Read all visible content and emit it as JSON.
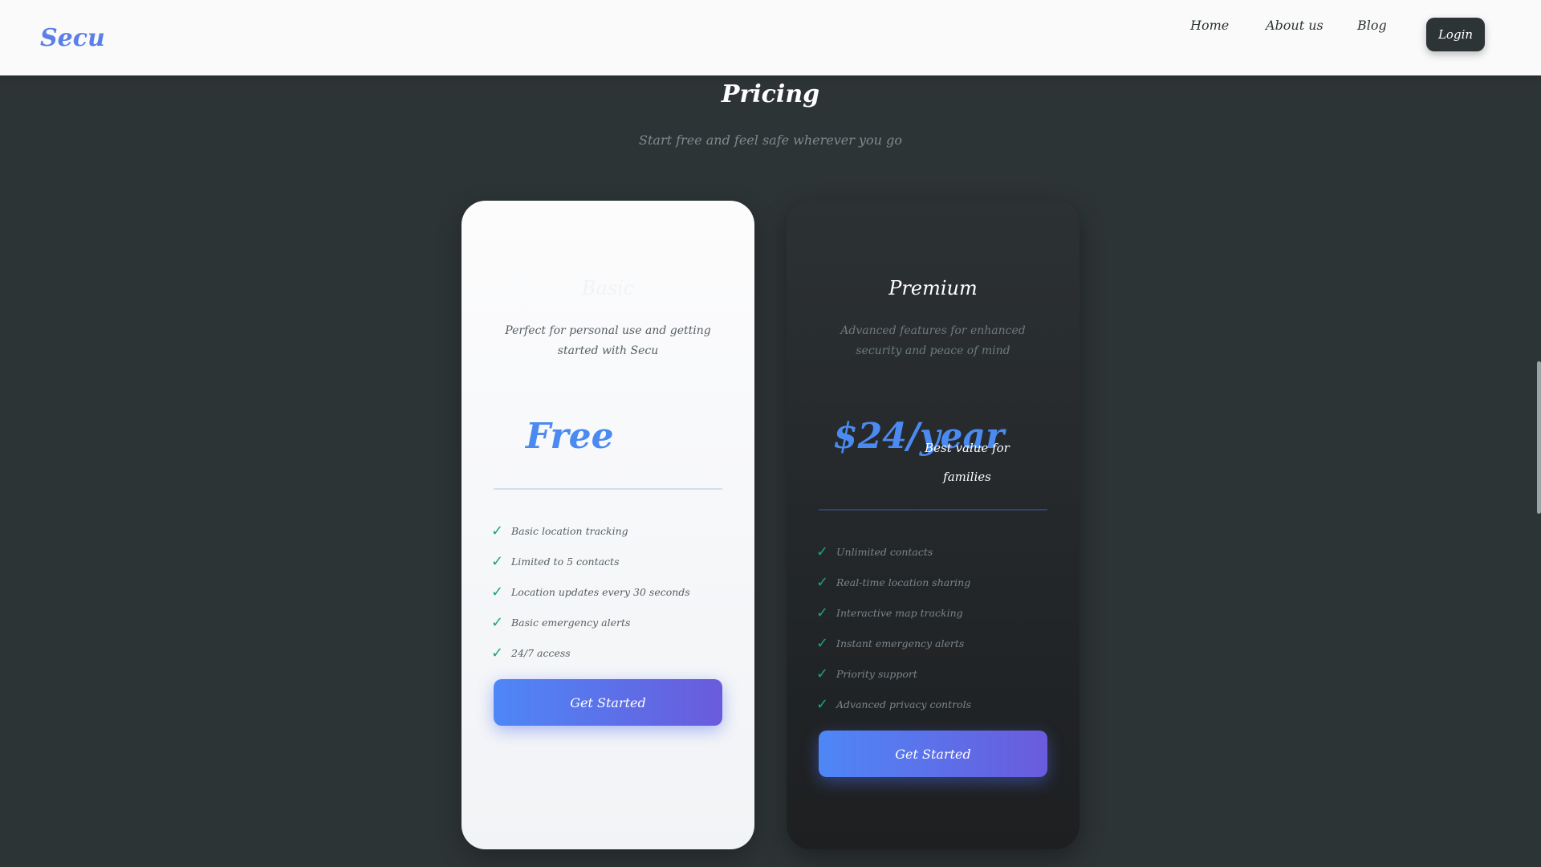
{
  "brand": {
    "logo": "Secu"
  },
  "nav": {
    "links": [
      "Home",
      "About us",
      "Blog"
    ],
    "login_label": "Login"
  },
  "section": {
    "title": "Pricing",
    "subtitle": "Start free and feel safe wherever you go"
  },
  "plans": [
    {
      "name": "Basic",
      "description": "Perfect for personal use and getting started with Secu",
      "price": "Free",
      "price_note": [],
      "features": [
        "Basic location tracking",
        "Limited to 5 contacts",
        "Location updates every 30 seconds",
        "Basic emergency alerts",
        "24/7 access"
      ],
      "cta": "Get Started"
    },
    {
      "name": "Premium",
      "description": "Advanced features for enhanced security and peace of mind",
      "price": "$24/year",
      "price_note": [
        "Best value for",
        "families"
      ],
      "features": [
        "Unlimited contacts",
        "Real-time location sharing",
        "Interactive map tracking",
        "Instant emergency alerts",
        "Priority support",
        "Advanced privacy controls"
      ],
      "cta": "Get Started"
    }
  ],
  "colors": {
    "background": "#2d3436",
    "accent": "#4b8af0",
    "button_gradient_start": "#4e87f7",
    "button_gradient_end": "#6a5bdc",
    "check": "#1aa37a"
  },
  "icons": {
    "feature_check": "check-icon"
  }
}
